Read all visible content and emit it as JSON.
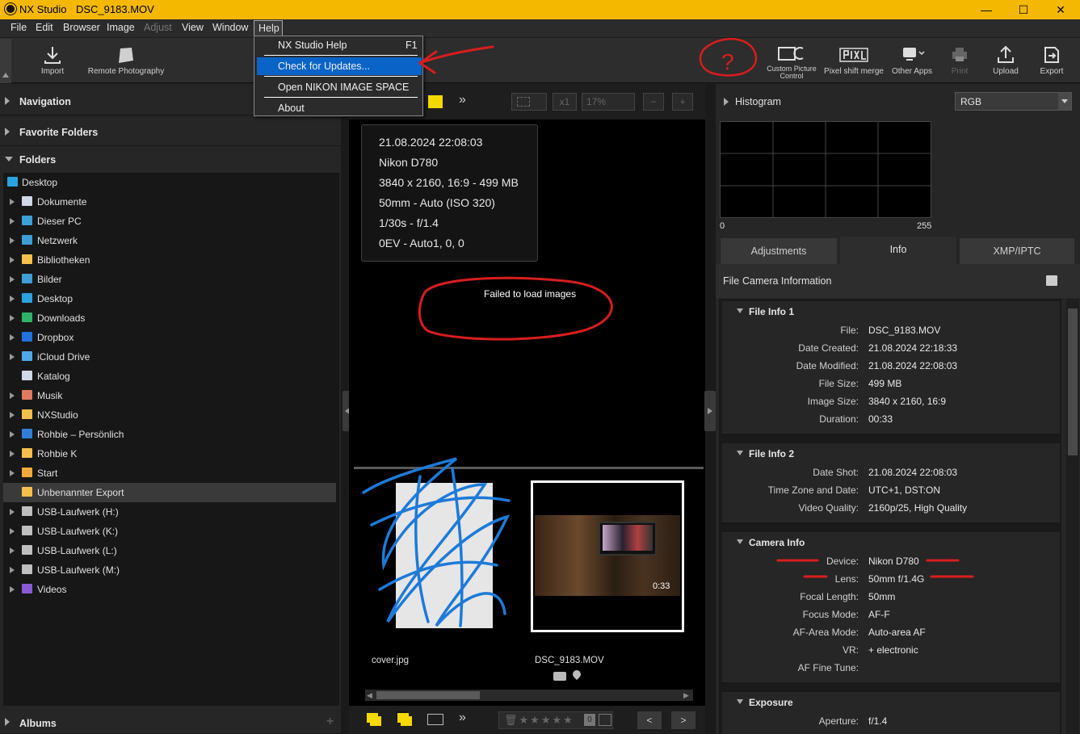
{
  "window": {
    "app_name": "NX Studio",
    "file_name": "DSC_9183.MOV",
    "minimize": "—",
    "maximize": "☐",
    "close": "✕"
  },
  "menu": {
    "items": [
      "File",
      "Edit",
      "Browser",
      "Image",
      "Adjust",
      "View",
      "Window",
      "Help"
    ],
    "disabled": [
      "Adjust"
    ]
  },
  "help_menu": {
    "items": [
      {
        "label": "NX Studio Help",
        "shortcut": "F1"
      },
      {
        "label": "Check for Updates..."
      },
      {
        "label": "Open NIKON IMAGE SPACE"
      },
      {
        "label": "About"
      }
    ],
    "highlighted": "Check for Updates..."
  },
  "toolbar": {
    "left": [
      {
        "label": "Import",
        "icon": "import-icon"
      },
      {
        "label": "Remote Photography",
        "icon": "camera-icon"
      }
    ],
    "right": [
      {
        "label": "Custom Picture Control",
        "line1": "Custom Picture",
        "line2": "Control",
        "icon": "custom-picture-icon"
      },
      {
        "label": "Pixel shift merge",
        "icon": "pixel-icon"
      },
      {
        "label": "Other Apps",
        "icon": "apps-icon"
      },
      {
        "label": "Print",
        "icon": "print-icon",
        "disabled": true
      },
      {
        "label": "Upload",
        "icon": "upload-icon"
      },
      {
        "label": "Export",
        "icon": "export-icon"
      }
    ]
  },
  "left_panel": {
    "navigation": "Navigation",
    "favorite_folders": "Favorite Folders",
    "folders": "Folders",
    "albums": "Albums",
    "tree": [
      {
        "label": "Desktop",
        "icon": "desktop-icon",
        "color": "#29a3e0",
        "root": true
      },
      {
        "label": "Dokumente",
        "icon": "document-icon",
        "color": "#d0d7e6"
      },
      {
        "label": "Dieser PC",
        "icon": "computer-icon",
        "color": "#3c9fd6"
      },
      {
        "label": "Netzwerk",
        "icon": "network-icon",
        "color": "#3c9fd6"
      },
      {
        "label": "Bibliotheken",
        "icon": "folder-icon",
        "color": "#f2c04b"
      },
      {
        "label": "Bilder",
        "icon": "pictures-icon",
        "color": "#3c9fd6"
      },
      {
        "label": "Desktop",
        "icon": "desktop-icon",
        "color": "#29a3e0"
      },
      {
        "label": "Downloads",
        "icon": "download-icon",
        "color": "#2fb36a"
      },
      {
        "label": "Dropbox",
        "icon": "dropbox-icon",
        "color": "#1f72e0"
      },
      {
        "label": "iCloud Drive",
        "icon": "cloud-icon",
        "color": "#4fa7e8"
      },
      {
        "label": "Katalog",
        "icon": "catalog-icon",
        "color": "#d0d7e6",
        "leaf": true
      },
      {
        "label": "Musik",
        "icon": "music-icon",
        "color": "#e07a5f"
      },
      {
        "label": "NXStudio",
        "icon": "folder-icon",
        "color": "#f2c04b"
      },
      {
        "label": "Rohbie – Persönlich",
        "icon": "onedrive-icon",
        "color": "#2f7fd9"
      },
      {
        "label": "Rohbie K",
        "icon": "folder-icon",
        "color": "#f2c04b"
      },
      {
        "label": "Start",
        "icon": "home-icon",
        "color": "#f2a93b"
      },
      {
        "label": "Unbenannter Export",
        "icon": "folder-icon",
        "color": "#f2c04b",
        "selected": true,
        "leaf": true
      },
      {
        "label": "USB-Laufwerk (H:)",
        "icon": "drive-icon",
        "color": "#bfbfbf"
      },
      {
        "label": "USB-Laufwerk (K:)",
        "icon": "drive-icon",
        "color": "#bfbfbf"
      },
      {
        "label": "USB-Laufwerk (L:)",
        "icon": "drive-icon",
        "color": "#bfbfbf"
      },
      {
        "label": "USB-Laufwerk (M:)",
        "icon": "drive-icon",
        "color": "#bfbfbf"
      },
      {
        "label": "Videos",
        "icon": "video-icon",
        "color": "#8a5ad6"
      }
    ]
  },
  "viewer": {
    "zoom_fit": "x1",
    "zoom": "17%",
    "info": [
      "21.08.2024 22:08:03",
      "Nikon D780",
      "3840 x 2160, 16:9 - 499 MB",
      "50mm - Auto (ISO 320)",
      "1/30s - f/1.4",
      "0EV - Auto1, 0, 0"
    ],
    "error": "Failed to load images",
    "annotation": "?",
    "thumbs": [
      {
        "name": "cover.jpg"
      },
      {
        "name": "DSC_9183.MOV",
        "duration": "0:33"
      }
    ],
    "rating_count": "0"
  },
  "right_panel": {
    "histogram_title": "Histogram",
    "histogram_channel": "RGB",
    "hist_min": "0",
    "hist_max": "255",
    "tabs": [
      "Adjustments",
      "Info",
      "XMP/IPTC"
    ],
    "active_tab": "Info",
    "subheader": {
      "file": "File",
      "camera": "Camera Information"
    },
    "groups": [
      {
        "title": "File Info 1",
        "rows": [
          [
            "File:",
            "DSC_9183.MOV"
          ],
          [
            "Date Created:",
            "21.08.2024 22:18:33"
          ],
          [
            "Date Modified:",
            "21.08.2024 22:08:03"
          ],
          [
            "File Size:",
            "499 MB"
          ],
          [
            "Image Size:",
            "3840 x 2160, 16:9"
          ],
          [
            "Duration:",
            "00:33"
          ]
        ]
      },
      {
        "title": "File Info 2",
        "rows": [
          [
            "Date Shot:",
            "21.08.2024 22:08:03"
          ],
          [
            "Time Zone and Date:",
            "UTC+1, DST:ON"
          ],
          [
            "Video Quality:",
            "2160p/25, High Quality"
          ]
        ]
      },
      {
        "title": "Camera Info",
        "rows": [
          [
            "Device:",
            "Nikon D780"
          ],
          [
            "Lens:",
            "50mm f/1.4G"
          ],
          [
            "Focal Length:",
            "50mm"
          ],
          [
            "Focus Mode:",
            "AF-F"
          ],
          [
            "AF-Area Mode:",
            "Auto-area AF"
          ],
          [
            "VR:",
            "+ electronic"
          ],
          [
            "AF Fine Tune:",
            ""
          ]
        ]
      },
      {
        "title": "Exposure",
        "rows": [
          [
            "Aperture:",
            "f/1.4"
          ]
        ]
      }
    ]
  },
  "colors": {
    "accent": "#f5b800",
    "highlight": "#0a64c8",
    "annotation_red": "#d81d1d",
    "scribble_blue": "#1d7ad8"
  }
}
